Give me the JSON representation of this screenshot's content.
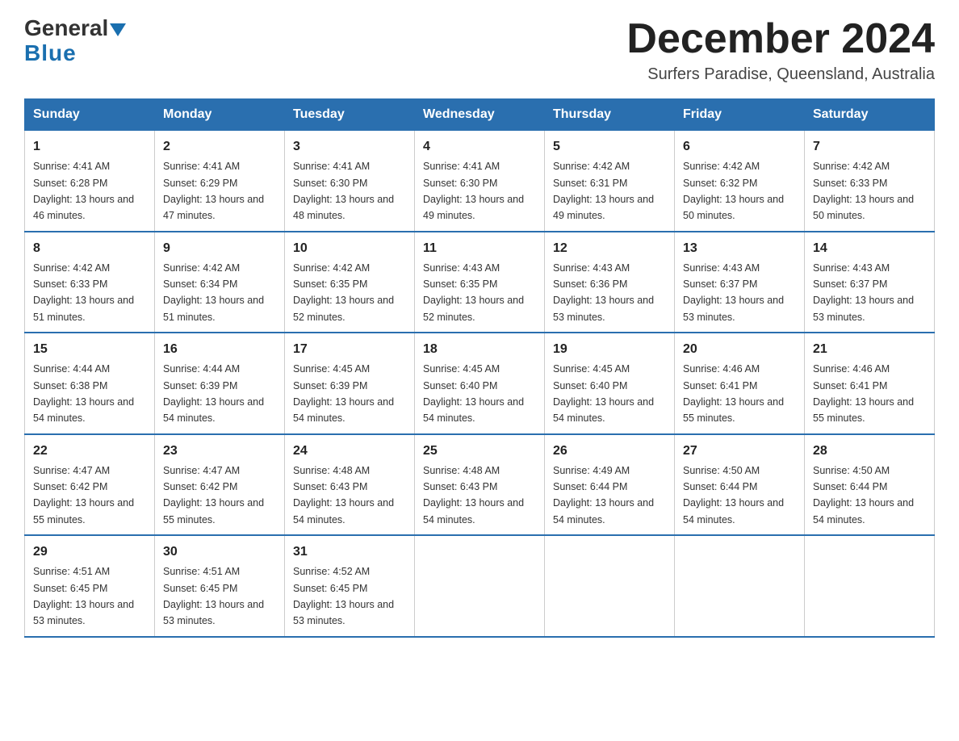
{
  "header": {
    "logo_general": "General",
    "logo_blue": "Blue",
    "main_title": "December 2024",
    "subtitle": "Surfers Paradise, Queensland, Australia"
  },
  "weekdays": [
    "Sunday",
    "Monday",
    "Tuesday",
    "Wednesday",
    "Thursday",
    "Friday",
    "Saturday"
  ],
  "weeks": [
    [
      {
        "day": "1",
        "sunrise": "4:41 AM",
        "sunset": "6:28 PM",
        "daylight": "13 hours and 46 minutes."
      },
      {
        "day": "2",
        "sunrise": "4:41 AM",
        "sunset": "6:29 PM",
        "daylight": "13 hours and 47 minutes."
      },
      {
        "day": "3",
        "sunrise": "4:41 AM",
        "sunset": "6:30 PM",
        "daylight": "13 hours and 48 minutes."
      },
      {
        "day": "4",
        "sunrise": "4:41 AM",
        "sunset": "6:30 PM",
        "daylight": "13 hours and 49 minutes."
      },
      {
        "day": "5",
        "sunrise": "4:42 AM",
        "sunset": "6:31 PM",
        "daylight": "13 hours and 49 minutes."
      },
      {
        "day": "6",
        "sunrise": "4:42 AM",
        "sunset": "6:32 PM",
        "daylight": "13 hours and 50 minutes."
      },
      {
        "day": "7",
        "sunrise": "4:42 AM",
        "sunset": "6:33 PM",
        "daylight": "13 hours and 50 minutes."
      }
    ],
    [
      {
        "day": "8",
        "sunrise": "4:42 AM",
        "sunset": "6:33 PM",
        "daylight": "13 hours and 51 minutes."
      },
      {
        "day": "9",
        "sunrise": "4:42 AM",
        "sunset": "6:34 PM",
        "daylight": "13 hours and 51 minutes."
      },
      {
        "day": "10",
        "sunrise": "4:42 AM",
        "sunset": "6:35 PM",
        "daylight": "13 hours and 52 minutes."
      },
      {
        "day": "11",
        "sunrise": "4:43 AM",
        "sunset": "6:35 PM",
        "daylight": "13 hours and 52 minutes."
      },
      {
        "day": "12",
        "sunrise": "4:43 AM",
        "sunset": "6:36 PM",
        "daylight": "13 hours and 53 minutes."
      },
      {
        "day": "13",
        "sunrise": "4:43 AM",
        "sunset": "6:37 PM",
        "daylight": "13 hours and 53 minutes."
      },
      {
        "day": "14",
        "sunrise": "4:43 AM",
        "sunset": "6:37 PM",
        "daylight": "13 hours and 53 minutes."
      }
    ],
    [
      {
        "day": "15",
        "sunrise": "4:44 AM",
        "sunset": "6:38 PM",
        "daylight": "13 hours and 54 minutes."
      },
      {
        "day": "16",
        "sunrise": "4:44 AM",
        "sunset": "6:39 PM",
        "daylight": "13 hours and 54 minutes."
      },
      {
        "day": "17",
        "sunrise": "4:45 AM",
        "sunset": "6:39 PM",
        "daylight": "13 hours and 54 minutes."
      },
      {
        "day": "18",
        "sunrise": "4:45 AM",
        "sunset": "6:40 PM",
        "daylight": "13 hours and 54 minutes."
      },
      {
        "day": "19",
        "sunrise": "4:45 AM",
        "sunset": "6:40 PM",
        "daylight": "13 hours and 54 minutes."
      },
      {
        "day": "20",
        "sunrise": "4:46 AM",
        "sunset": "6:41 PM",
        "daylight": "13 hours and 55 minutes."
      },
      {
        "day": "21",
        "sunrise": "4:46 AM",
        "sunset": "6:41 PM",
        "daylight": "13 hours and 55 minutes."
      }
    ],
    [
      {
        "day": "22",
        "sunrise": "4:47 AM",
        "sunset": "6:42 PM",
        "daylight": "13 hours and 55 minutes."
      },
      {
        "day": "23",
        "sunrise": "4:47 AM",
        "sunset": "6:42 PM",
        "daylight": "13 hours and 55 minutes."
      },
      {
        "day": "24",
        "sunrise": "4:48 AM",
        "sunset": "6:43 PM",
        "daylight": "13 hours and 54 minutes."
      },
      {
        "day": "25",
        "sunrise": "4:48 AM",
        "sunset": "6:43 PM",
        "daylight": "13 hours and 54 minutes."
      },
      {
        "day": "26",
        "sunrise": "4:49 AM",
        "sunset": "6:44 PM",
        "daylight": "13 hours and 54 minutes."
      },
      {
        "day": "27",
        "sunrise": "4:50 AM",
        "sunset": "6:44 PM",
        "daylight": "13 hours and 54 minutes."
      },
      {
        "day": "28",
        "sunrise": "4:50 AM",
        "sunset": "6:44 PM",
        "daylight": "13 hours and 54 minutes."
      }
    ],
    [
      {
        "day": "29",
        "sunrise": "4:51 AM",
        "sunset": "6:45 PM",
        "daylight": "13 hours and 53 minutes."
      },
      {
        "day": "30",
        "sunrise": "4:51 AM",
        "sunset": "6:45 PM",
        "daylight": "13 hours and 53 minutes."
      },
      {
        "day": "31",
        "sunrise": "4:52 AM",
        "sunset": "6:45 PM",
        "daylight": "13 hours and 53 minutes."
      },
      null,
      null,
      null,
      null
    ]
  ]
}
